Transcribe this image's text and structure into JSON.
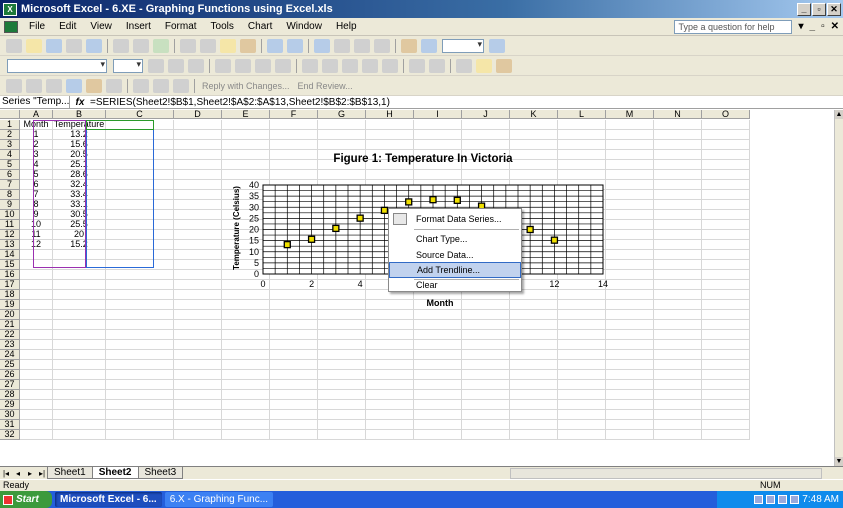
{
  "window": {
    "title": "Microsoft Excel - 6.XE - Graphing Functions using Excel.xls",
    "app_icon": "excel-icon",
    "controls": [
      "_",
      "▫",
      "✕"
    ]
  },
  "menu": {
    "items": [
      "File",
      "Edit",
      "View",
      "Insert",
      "Format",
      "Tools",
      "Chart",
      "Window",
      "Help"
    ],
    "help_placeholder": "Type a question for help",
    "mdi_controls": [
      "▾",
      "_",
      "▫",
      "✕"
    ]
  },
  "toolbar3": {
    "reply_label": "Reply with Changes...",
    "end_review_label": "End Review..."
  },
  "formula_bar": {
    "name_box": "Series \"Temp...",
    "fx": "fx",
    "formula": "=SERIES(Sheet2!$B$1,Sheet2!$A$2:$A$13,Sheet2!$B$2:$B$13,1)"
  },
  "grid": {
    "columns": [
      "A",
      "B",
      "C",
      "D",
      "E",
      "F",
      "G",
      "H",
      "I",
      "J",
      "K",
      "L",
      "M",
      "N",
      "O"
    ],
    "row_count": 32,
    "data": [
      [
        "Month",
        "Temperature"
      ],
      [
        "1",
        "13.2"
      ],
      [
        "2",
        "15.6"
      ],
      [
        "3",
        "20.5"
      ],
      [
        "4",
        "25.1"
      ],
      [
        "5",
        "28.6"
      ],
      [
        "6",
        "32.4"
      ],
      [
        "7",
        "33.4"
      ],
      [
        "8",
        "33.1"
      ],
      [
        "9",
        "30.5"
      ],
      [
        "10",
        "25.5"
      ],
      [
        "11",
        "20"
      ],
      [
        "12",
        "15.2"
      ]
    ]
  },
  "chart_data": {
    "type": "scatter",
    "title": "Figure 1: Temperature In Victoria",
    "xlabel": "Month",
    "ylabel": "Temperature (Celsius)",
    "xlim": [
      0,
      14
    ],
    "ylim": [
      0,
      40
    ],
    "xticks": [
      0,
      2,
      4,
      6,
      8,
      10,
      12,
      14
    ],
    "yticks": [
      0,
      5,
      10,
      15,
      20,
      25,
      30,
      35,
      40
    ],
    "grid": true,
    "legend": "none",
    "marker_fill": "#f0e000",
    "x": [
      1,
      2,
      3,
      4,
      5,
      6,
      7,
      8,
      9,
      10,
      11,
      12
    ],
    "y": [
      13.2,
      15.6,
      20.5,
      25.1,
      28.6,
      32.4,
      33.4,
      33.1,
      30.5,
      25.5,
      20,
      15.2
    ]
  },
  "context_menu": {
    "items": [
      {
        "label": "Format Data Series...",
        "icon": "format-series-icon"
      },
      {
        "label": "Chart Type..."
      },
      {
        "label": "Source Data..."
      },
      {
        "label": "Add Trendline...",
        "highlighted": true
      },
      {
        "label": "Clear"
      }
    ]
  },
  "sheets": {
    "tabs": [
      "Sheet1",
      "Sheet2",
      "Sheet3"
    ],
    "active": "Sheet2",
    "nav": [
      "|◂",
      "◂",
      "▸",
      "▸|"
    ]
  },
  "status": {
    "ready": "Ready",
    "num": "NUM"
  },
  "taskbar": {
    "start": "Start",
    "items": [
      "Microsoft Excel - 6...",
      "6.X - Graphing Func..."
    ],
    "clock": "7:48 AM"
  },
  "colors": {
    "title_bar": "#0a246a",
    "selection_month": "#9b30b0",
    "selection_temperature": "#2a6ad8",
    "menu_highlight": "#c1d2ee",
    "taskbar": "#245edb",
    "start_button": "#3c9a3c"
  }
}
